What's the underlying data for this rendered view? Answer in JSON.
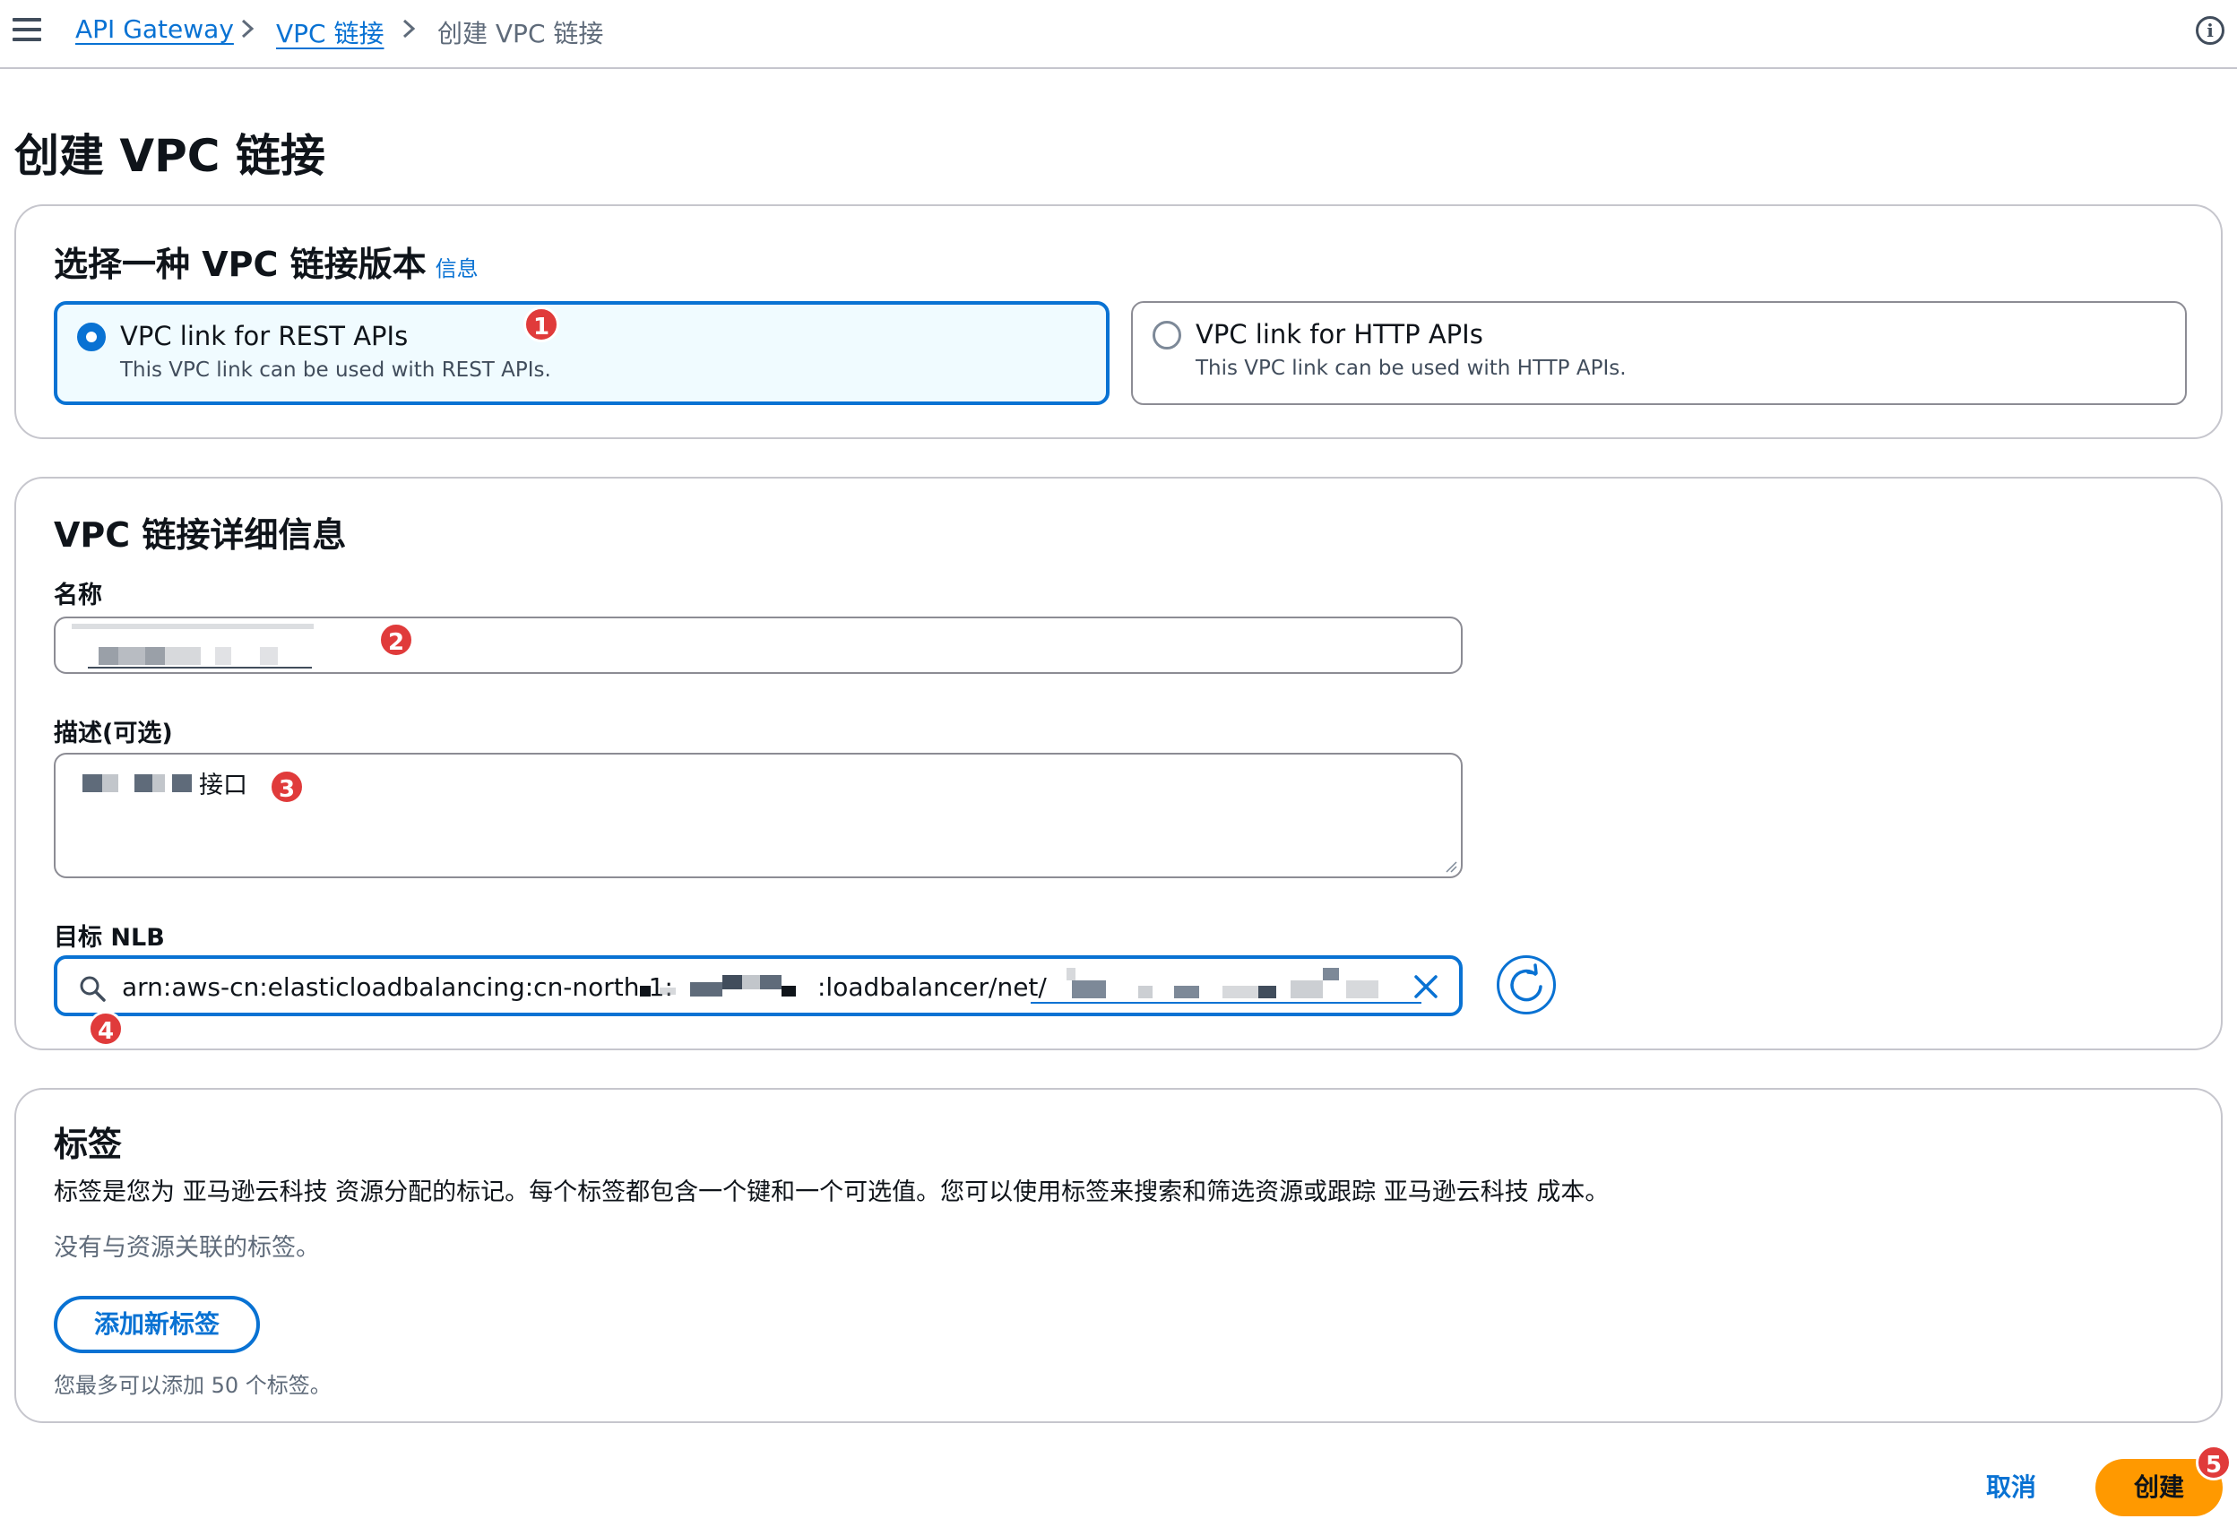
{
  "breadcrumb": {
    "items": [
      "API Gateway",
      "VPC 链接"
    ],
    "current": "创建 VPC 链接"
  },
  "page": {
    "title": "创建 VPC 链接"
  },
  "version_section": {
    "title": "选择一种 VPC 链接版本",
    "info_link": "信息",
    "options": [
      {
        "label": "VPC link for REST APIs",
        "description": "This VPC link can be used with REST APIs.",
        "selected": true
      },
      {
        "label": "VPC link for HTTP APIs",
        "description": "This VPC link can be used with HTTP APIs.",
        "selected": false
      }
    ]
  },
  "details_section": {
    "title": "VPC 链接详细信息",
    "name_label": "名称",
    "description_label": "描述(可选)",
    "description_value_visible": "接口",
    "target_label": "目标 NLB",
    "target_value_prefix": "arn:aws-cn:elasticloadbalancing:cn-north-1:",
    "target_value_mid": ":loadbalancer/net/"
  },
  "tags_section": {
    "title": "标签",
    "description": "标签是您为 亚马逊云科技 资源分配的标记。每个标签都包含一个键和一个可选值。您可以使用标签来搜索和筛选资源或跟踪 亚马逊云科技 成本。",
    "empty_text": "没有与资源关联的标签。",
    "add_button": "添加新标签",
    "limit_text": "您最多可以添加 50 个标签。"
  },
  "actions": {
    "cancel": "取消",
    "create": "创建"
  },
  "annotations": [
    "1",
    "2",
    "3",
    "4",
    "5"
  ],
  "icons": [
    "menu-icon",
    "chevron-right-icon",
    "info-icon",
    "search-icon",
    "close-icon",
    "refresh-icon"
  ],
  "colors": {
    "accent": "#0972d3",
    "primary_button": "#ff9900",
    "badge": "#e03b3b",
    "selected_tile_bg": "#f0fbff"
  }
}
